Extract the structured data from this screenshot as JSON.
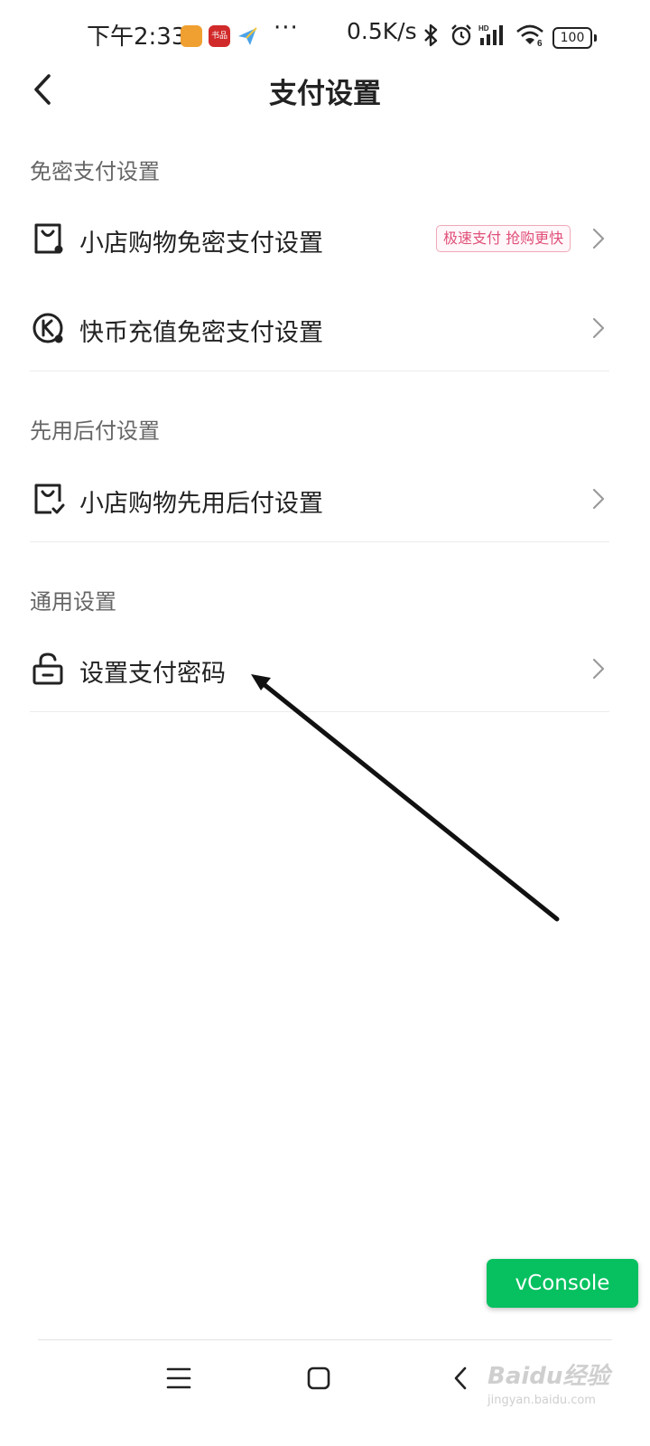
{
  "status_bar": {
    "time": "下午2:33",
    "app_badge_2": "书品",
    "dots": "···",
    "net_speed": "0.5K/s",
    "battery": "100",
    "icons": [
      "bluetooth-icon",
      "alarm-icon",
      "hd-signal-icon",
      "wifi-icon",
      "battery-icon"
    ]
  },
  "header": {
    "title": "支付设置",
    "back_icon": "chevron-left-icon"
  },
  "sections": [
    {
      "title": "免密支付设置",
      "items": [
        {
          "label": "小店购物免密支付设置",
          "icon": "shopping-bag-icon",
          "badge": "极速支付 抢购更快"
        },
        {
          "label": "快币充值免密支付设置",
          "icon": "kuaibi-coin-icon"
        }
      ]
    },
    {
      "title": "先用后付设置",
      "items": [
        {
          "label": "小店购物先用后付设置",
          "icon": "shopping-bag-check-icon"
        }
      ]
    },
    {
      "title": "通用设置",
      "items": [
        {
          "label": "设置支付密码",
          "icon": "lock-icon"
        }
      ]
    }
  ],
  "vconsole": {
    "label": "vConsole"
  },
  "colors": {
    "accent": "#07c160",
    "badge_text": "#e0507a",
    "badge_border": "#f0a8b8"
  },
  "nav_bar": {
    "icons": [
      "menu-icon",
      "home-square-icon",
      "back-icon"
    ]
  },
  "watermark": {
    "text": "Baidu经验",
    "sub": "jingyan.baidu.com"
  }
}
